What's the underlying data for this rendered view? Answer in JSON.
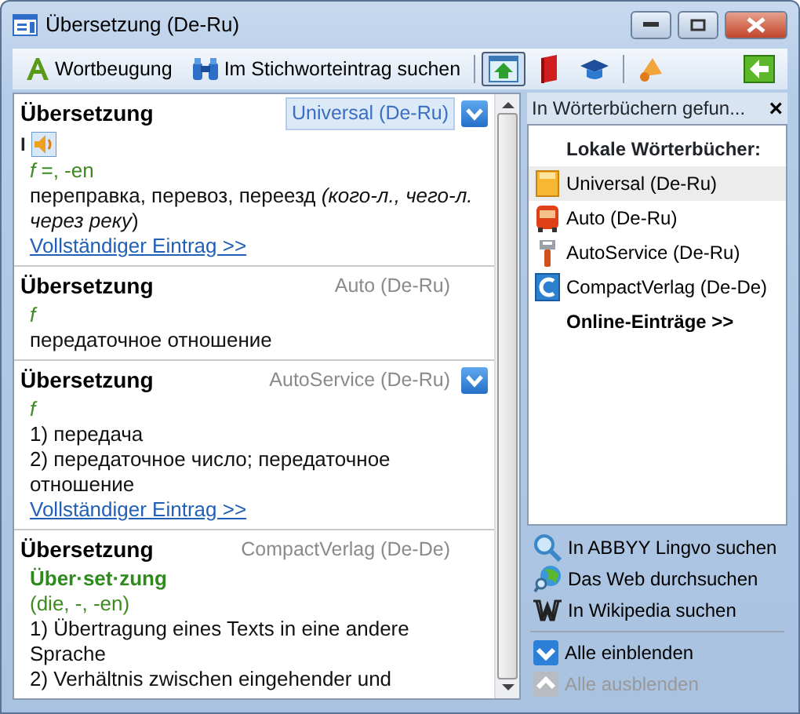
{
  "window": {
    "title": "Übersetzung (De-Ru)"
  },
  "toolbar": [
    {
      "kind": "text",
      "label": "Wortbeugung"
    },
    {
      "kind": "text",
      "label": "Im Stichworteintrag suchen"
    },
    {
      "kind": "sep"
    },
    {
      "kind": "icon",
      "selected": true
    },
    {
      "kind": "icon",
      "selected": false
    },
    {
      "kind": "icon",
      "selected": false
    },
    {
      "kind": "sep"
    },
    {
      "kind": "icon",
      "selected": false
    },
    {
      "kind": "back"
    }
  ],
  "entries": [
    {
      "title": "Übersetzung",
      "source": "Universal (De-Ru)",
      "source_selected": true,
      "expand_button": true,
      "lines": [
        {
          "kind": "pron",
          "text": "I"
        },
        {
          "kind": "gram",
          "text": "*f* =, -en"
        },
        {
          "kind": "text",
          "text": "переправка, перевоз, переезд *(кого-л., чего-л. через реку*)"
        },
        {
          "kind": "link",
          "text": "Vollständiger Eintrag >>"
        }
      ]
    },
    {
      "title": "Übersetzung",
      "source": "Auto (De-Ru)",
      "source_selected": false,
      "expand_button": false,
      "lines": [
        {
          "kind": "gram",
          "text": "*f*"
        },
        {
          "kind": "text",
          "text": "передаточное отношение"
        }
      ]
    },
    {
      "title": "Übersetzung",
      "source": "AutoService (De-Ru)",
      "source_selected": false,
      "expand_button": true,
      "lines": [
        {
          "kind": "gram",
          "text": "*f*"
        },
        {
          "kind": "text",
          "text": "1) передача"
        },
        {
          "kind": "text",
          "text": "2) передаточное число; передаточное отношение"
        },
        {
          "kind": "link",
          "text": "Vollständiger Eintrag >>"
        }
      ]
    },
    {
      "title": "Übersetzung",
      "source": "CompactVerlag (De-De)",
      "source_selected": false,
      "expand_button": false,
      "lines": [
        {
          "kind": "headword",
          "text": "Über·set·zung"
        },
        {
          "kind": "gram",
          "text": "(die, -, -en)"
        },
        {
          "kind": "text",
          "text": "1) Übertragung eines Texts in eine andere Sprache"
        },
        {
          "kind": "text",
          "text": "2) Verhältnis zwischen eingehender und"
        }
      ]
    }
  ],
  "side_panel": {
    "title": "In Wörterbüchern gefun...",
    "close": "×",
    "heading": "Lokale Wörterbücher:",
    "dictionaries": [
      {
        "label": "Universal (De-Ru)",
        "selected": true
      },
      {
        "label": "Auto (De-Ru)",
        "selected": false
      },
      {
        "label": "AutoService (De-Ru)",
        "selected": false
      },
      {
        "label": "CompactVerlag (De-De)",
        "selected": false
      }
    ],
    "online": "Online-Einträge >>",
    "searches": [
      {
        "label": "In ABBYY Lingvo suchen"
      },
      {
        "label": "Das Web durchsuchen"
      },
      {
        "label": "In Wikipedia suchen"
      }
    ],
    "actions": [
      {
        "label": "Alle einblenden",
        "disabled": false
      },
      {
        "label": "Alle ausblenden",
        "disabled": true
      }
    ]
  }
}
